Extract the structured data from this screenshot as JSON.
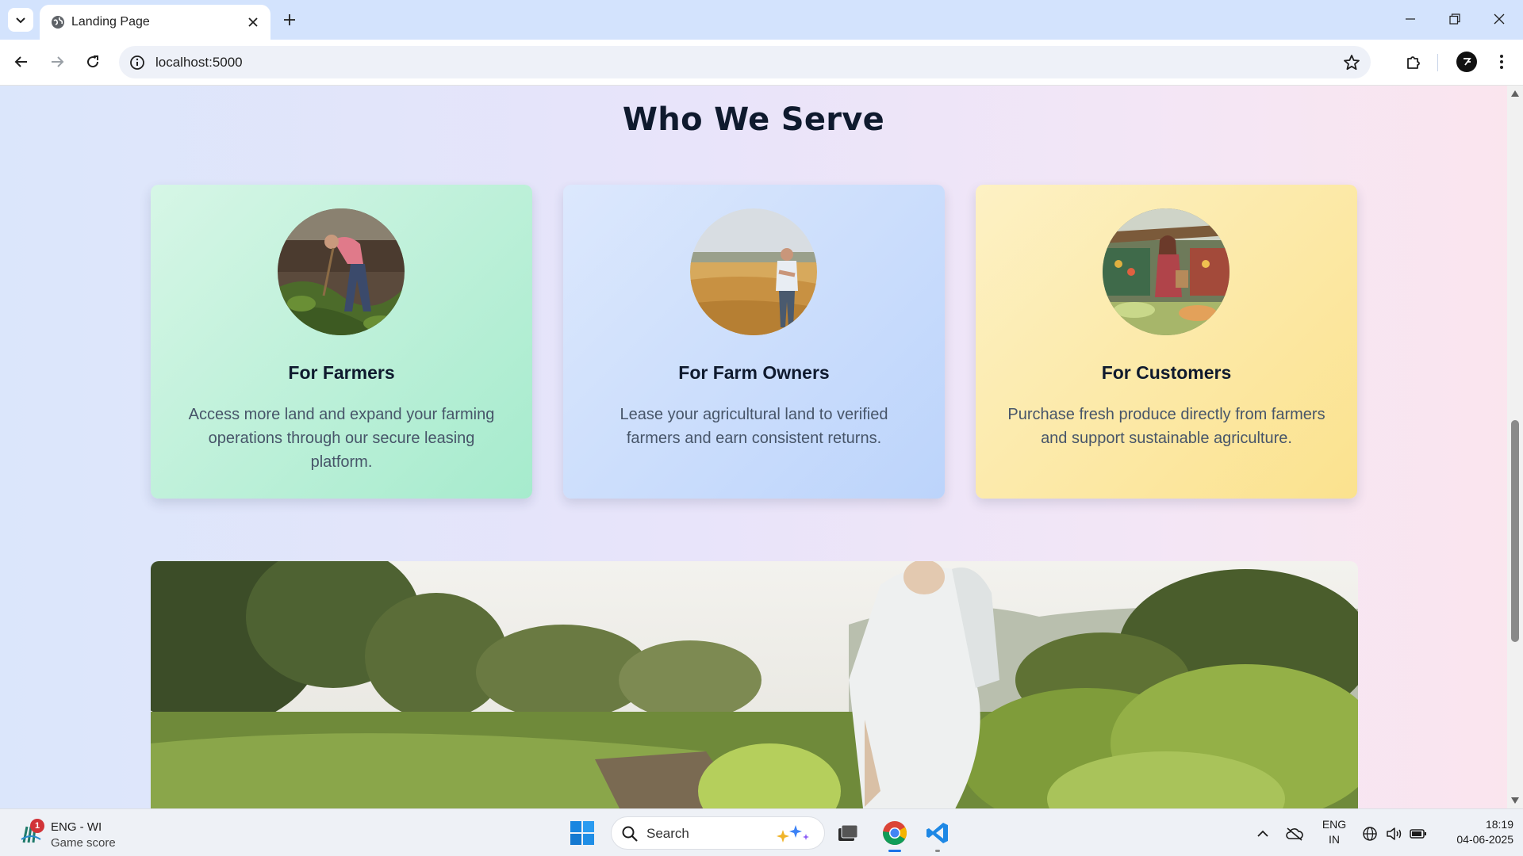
{
  "browser": {
    "tab_title": "Landing Page",
    "url": "localhost:5000"
  },
  "page": {
    "section_title": "Who We Serve",
    "cards": [
      {
        "title": "For Farmers",
        "description": "Access more land and expand your farming operations through our secure leasing platform.",
        "accent": "#a6ebcd",
        "image": "farmer-working-soil-photo"
      },
      {
        "title": "For Farm Owners",
        "description": "Lease your agricultural land to verified farmers and earn consistent returns.",
        "accent": "#bcd4fb",
        "image": "farm-owner-wheat-field-photo"
      },
      {
        "title": "For Customers",
        "description": "Purchase fresh produce directly from farmers and support sustainable agriculture.",
        "accent": "#fbe28e",
        "image": "customer-market-produce-photo"
      }
    ],
    "hero_image": "farmer-tending-crops-photo"
  },
  "taskbar": {
    "widget_badge": "1",
    "widget_line1": "ENG - WI",
    "widget_line2": "Game score",
    "search_placeholder": "Search",
    "lang_line1": "ENG",
    "lang_line2": "IN",
    "time": "18:19",
    "date": "04-06-2025"
  }
}
